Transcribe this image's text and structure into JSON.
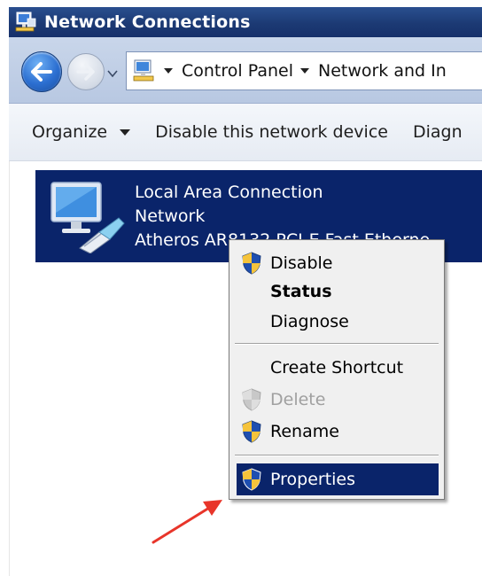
{
  "window": {
    "title": "Network Connections"
  },
  "address_bar": {
    "crumbs": [
      "Control Panel",
      "Network and In"
    ]
  },
  "command_bar": {
    "organize_label": "Organize",
    "disable_label": "Disable this network device",
    "diagnose_label": "Diagn"
  },
  "connection": {
    "name": "Local Area Connection",
    "type": "Network",
    "adapter": "Atheros AR8132 PCI-E Fast Etherne..."
  },
  "context_menu": {
    "items": [
      {
        "label": "Disable",
        "icon": "uac-shield-icon"
      },
      {
        "label": "Status",
        "icon": ""
      },
      {
        "label": "Diagnose",
        "icon": ""
      },
      {
        "label": "Create Shortcut",
        "icon": ""
      },
      {
        "label": "Delete",
        "icon": "uac-shield-icon"
      },
      {
        "label": "Rename",
        "icon": "uac-shield-icon"
      },
      {
        "label": "Properties",
        "icon": "uac-shield-icon"
      }
    ]
  },
  "colors": {
    "selection": "#0a246a",
    "title_bar": "#1c3a74",
    "annotation_arrow": "#e8352a"
  }
}
